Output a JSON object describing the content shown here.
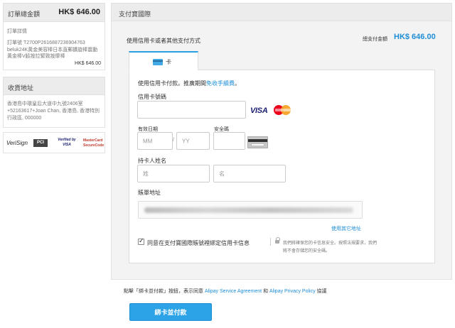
{
  "sidebar": {
    "order_total_label": "訂單總金額",
    "order_total_amount": "HK$ 646.00",
    "order_details_label": "訂單詳情",
    "order_number": "訂單號 T2700P2616887236904763",
    "order_item": "beluk24K黃金美容棒日本直郵擴旋棒震動黃金棒V臉按拉緊致按摩棒",
    "order_item_amount": "HK$ 646.00",
    "address_label": "收貨地址",
    "address_text": "香港島中環皇后大道中九號2406室+52163617+Joan Chan, 香港島, 香港特別行政區, 000000",
    "logos": [
      "VeriSign",
      "PCI",
      "Verified by VISA",
      "MasterCard SecureCode"
    ]
  },
  "main": {
    "header": "支付寶國際",
    "subtitle": "使用信用卡或者其他支付方式",
    "total_label": "總支付金額",
    "total_amount": "HK$ 646.00",
    "tab_label": "卡",
    "promo_text": "使用信用卡付款。推廣期間",
    "promo_link": "免收手續費",
    "promo_end": "。",
    "card_number_label": "信用卡號碼",
    "brands": [
      "VISA",
      "MasterCard"
    ],
    "expiry_label": "有效日期",
    "expiry_mm": "MM",
    "expiry_sep": "/",
    "expiry_yy": "YY",
    "cvv_label": "安全碼",
    "holder_label": "持卡人姓名",
    "first_name": "姓",
    "last_name": "名",
    "billing_label": "賬單地址",
    "other_address_link": "使用其它地址",
    "save_card_text": "同意在支付寶國際賬號裡綁定信用卡信息",
    "security_note_1": "我們將確保您的卡信息安全。按照法規要求，我們",
    "security_note_2": "將不會存儲您的安全碼。",
    "footer_prefix": "點擊「綁卡並付款」按鈕，表示同意",
    "footer_link_1": "Alipay Service Agreement",
    "footer_and": "和",
    "footer_link_2": "Alipay Privacy Policy",
    "footer_suffix": "協議",
    "submit_button": "綁卡並付款"
  },
  "colors": {
    "accent": "#2ba3e6",
    "amount": "#1e8ed6"
  }
}
